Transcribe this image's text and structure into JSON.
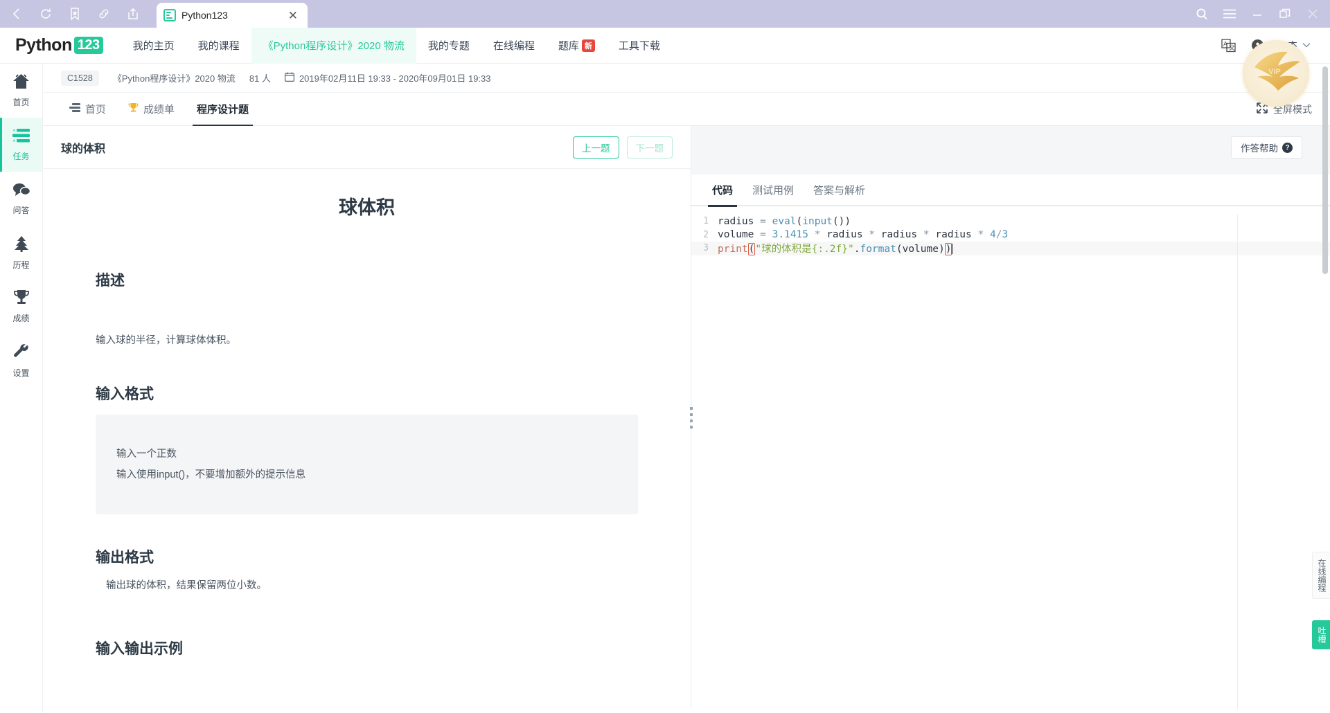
{
  "browser": {
    "nav_icons": [
      "back-icon",
      "reload-icon",
      "bookmark-icon",
      "link-icon",
      "share-icon"
    ],
    "tab": {
      "title": "Python123",
      "favicon": "page-list-icon",
      "close": "✕"
    },
    "window_controls": [
      "search-icon",
      "menu-icon",
      "minimize-icon",
      "restore-icon",
      "close-icon"
    ]
  },
  "header": {
    "brand": {
      "text": "Python",
      "badge": "123"
    },
    "nav": [
      {
        "label": "我的主页",
        "active": false
      },
      {
        "label": "我的课程",
        "active": false
      },
      {
        "label": "《Python程序设计》2020 物流",
        "active": true
      },
      {
        "label": "我的专题",
        "active": false
      },
      {
        "label": "在线编程",
        "active": false
      },
      {
        "label": "题库",
        "active": false,
        "badge": "新"
      },
      {
        "label": "工具下载",
        "active": false
      }
    ],
    "translate_icon": "translate-icon",
    "user": {
      "name": "夏宇杰",
      "caret": "⌄"
    },
    "vip_badge": "VIP"
  },
  "rail": [
    {
      "label": "首页",
      "icon": "home-icon",
      "active": false
    },
    {
      "label": "任务",
      "icon": "tasks-icon",
      "active": true
    },
    {
      "label": "问答",
      "icon": "chat-icon",
      "active": false
    },
    {
      "label": "历程",
      "icon": "tree-icon",
      "active": false
    },
    {
      "label": "成绩",
      "icon": "trophy-icon",
      "active": false
    },
    {
      "label": "设置",
      "icon": "wrench-icon",
      "active": false
    }
  ],
  "info_bar": {
    "course_code": "C1528",
    "course_name": "《Python程序设计》2020 物流",
    "members": "81 人",
    "calendar_icon": "calendar-icon",
    "date_range": "2019年02月11日 19:33 - 2020年09月01日 19:33"
  },
  "tabs": [
    {
      "label": "首页",
      "icon": "list-icon",
      "active": false
    },
    {
      "label": "成绩单",
      "icon": "trophy-icon",
      "active": false
    },
    {
      "label": "程序设计题",
      "icon": "",
      "active": true
    }
  ],
  "fullscreen": {
    "label": "全屏模式",
    "icon": "expand-icon"
  },
  "problem": {
    "name": "球的体积",
    "prev_label": "上一题",
    "next_label": "下一题",
    "doc_title": "球体积",
    "sections": [
      {
        "heading": "描述",
        "type": "para",
        "text": "输入球的半径，计算球体体积。"
      },
      {
        "heading": "输入格式",
        "type": "block",
        "lines": [
          "输入一个正数",
          "输入使用input()，不要增加额外的提示信息"
        ]
      },
      {
        "heading": "输出格式",
        "type": "para-indent",
        "text": "输出球的体积，结果保留两位小数。"
      },
      {
        "heading": "输入输出示例",
        "type": "cut"
      }
    ]
  },
  "editor": {
    "help_label": "作答帮助",
    "help_icon": "question-mark-icon",
    "tabs": [
      {
        "label": "代码",
        "active": true
      },
      {
        "label": "测试用例",
        "active": false
      },
      {
        "label": "答案与解析",
        "active": false
      }
    ],
    "lines": [
      {
        "n": "1",
        "code": "radius = eval(input())"
      },
      {
        "n": "2",
        "code": "volume = 3.1415 * radius * radius * radius * 4/3"
      },
      {
        "n": "3",
        "code": "print(\"球的体积是{:.2f}\".format(volume))"
      }
    ]
  },
  "right_edge": {
    "online_prog": "在线编程",
    "feedback": "吐槽"
  },
  "colors": {
    "accent": "#26c99a",
    "chrome": "#c6c6e2",
    "badge_red": "#e8453c",
    "text_dark": "#2d3a45"
  }
}
